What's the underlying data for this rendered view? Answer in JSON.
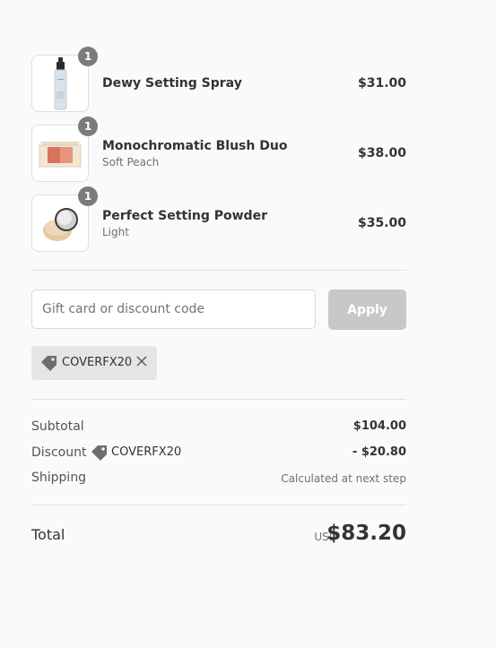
{
  "line_items": [
    {
      "name": "Dewy Setting Spray",
      "variant": "",
      "price": "$31.00",
      "quantity": "1",
      "image_icon": "setting-spray-bottle"
    },
    {
      "name": "Monochromatic Blush Duo",
      "variant": "Soft Peach",
      "price": "$38.00",
      "quantity": "1",
      "image_icon": "blush-palette"
    },
    {
      "name": "Perfect Setting Powder",
      "variant": "Light",
      "price": "$35.00",
      "quantity": "1",
      "image_icon": "loose-powder-jar"
    }
  ],
  "discount_form": {
    "placeholder": "Gift card or discount code",
    "value": "",
    "apply_label": "Apply"
  },
  "applied_discount": {
    "code": "COVERFX20",
    "icon": "tag-icon",
    "remove_icon": "close-icon"
  },
  "summary": {
    "subtotal_label": "Subtotal",
    "subtotal_value": "$104.00",
    "discount_label": "Discount",
    "discount_code": "COVERFX20",
    "discount_value": "- $20.80",
    "shipping_label": "Shipping",
    "shipping_value": "Calculated at next step",
    "total_label": "Total",
    "currency": "USD",
    "total_value": "$83.20"
  },
  "colors": {
    "background": "#fafafa",
    "badge": "#7b7b7b",
    "apply_disabled": "#c8c8c8",
    "chip": "#e5e5e5"
  }
}
